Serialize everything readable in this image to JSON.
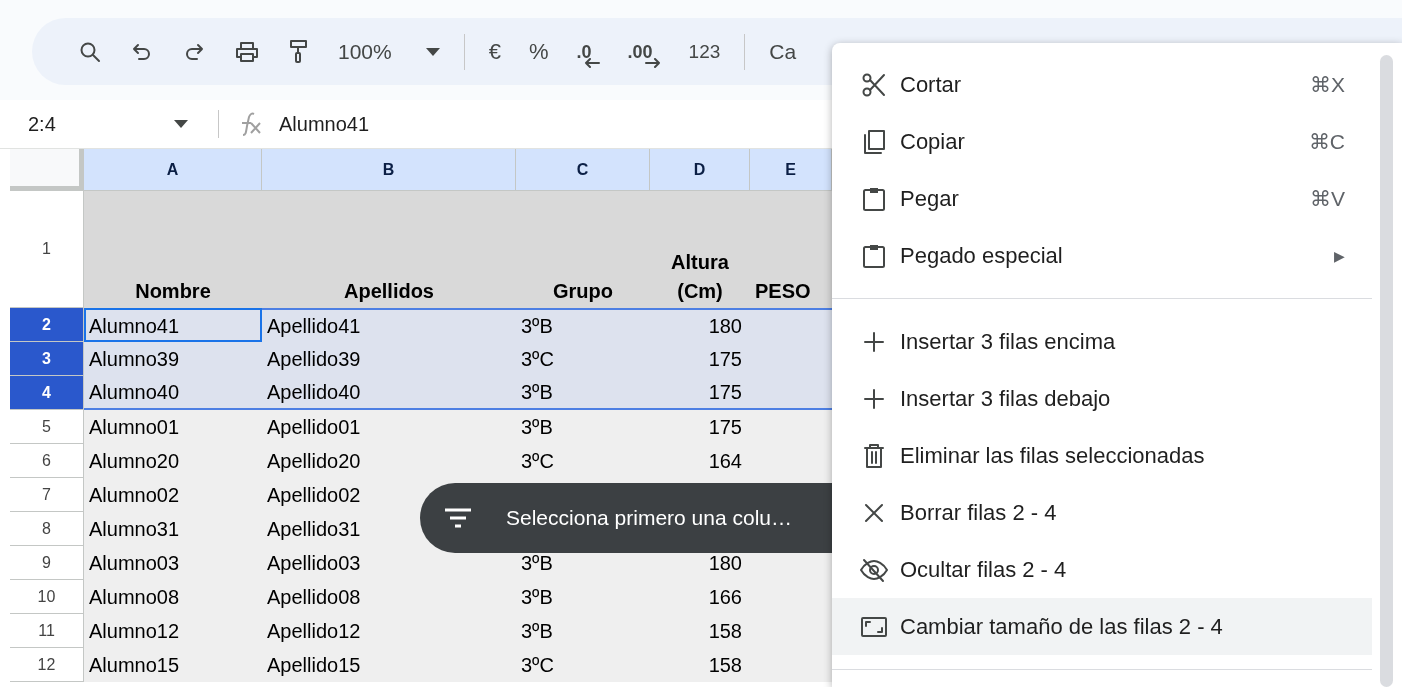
{
  "toolbar": {
    "zoom": "100%",
    "format_buttons": [
      {
        "kind": "currency",
        "label": "€"
      },
      {
        "kind": "percent",
        "label": "%"
      },
      {
        "kind": "decrease",
        "label": ".0"
      },
      {
        "kind": "increase",
        "label": ".00"
      },
      {
        "kind": "plain",
        "label": "123"
      }
    ],
    "font": "Ca"
  },
  "formula_bar": {
    "name_box": "2:4",
    "formula": "Alumno41"
  },
  "columns": [
    "A",
    "B",
    "C",
    "D",
    "E"
  ],
  "rows": [
    {
      "number": "1",
      "kind": "header",
      "selected": false,
      "cells": [
        {
          "text": "Nombre"
        },
        {
          "text": "Apellidos"
        },
        {
          "text": "Grupo"
        },
        {
          "text": "Altura (Cm)"
        },
        {
          "text": "PESO"
        }
      ]
    },
    {
      "number": "2",
      "kind": "data",
      "selected": true,
      "cells": [
        {
          "text": "Alumno41",
          "active": true
        },
        {
          "text": "Apellido41",
          "active": false
        },
        {
          "text": "3ºB",
          "active": false
        },
        {
          "text": "180",
          "active": false
        }
      ]
    },
    {
      "number": "3",
      "kind": "data",
      "selected": true,
      "cells": [
        {
          "text": "Alumno39",
          "active": false
        },
        {
          "text": "Apellido39",
          "active": false
        },
        {
          "text": "3ºC",
          "active": false
        },
        {
          "text": "175",
          "active": false
        }
      ]
    },
    {
      "number": "4",
      "kind": "data",
      "selected": true,
      "cells": [
        {
          "text": "Alumno40",
          "active": false
        },
        {
          "text": "Apellido40",
          "active": false
        },
        {
          "text": "3ºB",
          "active": false
        },
        {
          "text": "175",
          "active": false
        }
      ]
    },
    {
      "number": "5",
      "kind": "data",
      "selected": false,
      "cells": [
        {
          "text": "Alumno01",
          "active": false
        },
        {
          "text": "Apellido01",
          "active": false
        },
        {
          "text": "3ºB",
          "active": false
        },
        {
          "text": "175",
          "active": false
        }
      ]
    },
    {
      "number": "6",
      "kind": "data",
      "selected": false,
      "cells": [
        {
          "text": "Alumno20",
          "active": false
        },
        {
          "text": "Apellido20",
          "active": false
        },
        {
          "text": "3ºC",
          "active": false
        },
        {
          "text": "164",
          "active": false
        }
      ]
    },
    {
      "number": "7",
      "kind": "data",
      "selected": false,
      "cells": [
        {
          "text": "Alumno02",
          "active": false
        },
        {
          "text": "Apellido02",
          "active": false
        }
      ]
    },
    {
      "number": "8",
      "kind": "data",
      "selected": false,
      "cells": [
        {
          "text": "Alumno31",
          "active": false
        },
        {
          "text": "Apellido31",
          "active": false
        }
      ]
    },
    {
      "number": "9",
      "kind": "data",
      "selected": false,
      "cells": [
        {
          "text": "Alumno03",
          "active": false
        },
        {
          "text": "Apellido03",
          "active": false
        },
        {
          "text": "3ºB",
          "active": false
        },
        {
          "text": "180",
          "active": false
        }
      ]
    },
    {
      "number": "10",
      "kind": "data",
      "selected": false,
      "cells": [
        {
          "text": "Alumno08",
          "active": false
        },
        {
          "text": "Apellido08",
          "active": false
        },
        {
          "text": "3ºB",
          "active": false
        },
        {
          "text": "166",
          "active": false
        }
      ]
    },
    {
      "number": "11",
      "kind": "data",
      "selected": false,
      "cells": [
        {
          "text": "Alumno12",
          "active": false
        },
        {
          "text": "Apellido12",
          "active": false
        },
        {
          "text": "3ºB",
          "active": false
        },
        {
          "text": "158",
          "active": false
        }
      ]
    },
    {
      "number": "12",
      "kind": "data",
      "selected": false,
      "cells": [
        {
          "text": "Alumno15",
          "active": false
        },
        {
          "text": "Apellido15",
          "active": false
        },
        {
          "text": "3ºC",
          "active": false
        },
        {
          "text": "158",
          "active": false
        }
      ]
    }
  ],
  "toast": {
    "text": "Selecciona primero una colu…"
  },
  "context_menu": {
    "sections": [
      [
        {
          "kind": "cut",
          "label": "Cortar",
          "shortcut": "⌘X",
          "highlighted": false
        },
        {
          "kind": "copy",
          "label": "Copiar",
          "shortcut": "⌘C",
          "highlighted": false
        },
        {
          "kind": "paste",
          "label": "Pegar",
          "shortcut": "⌘V",
          "highlighted": false
        },
        {
          "kind": "paste",
          "label": "Pegado especial",
          "submenu": "▶",
          "highlighted": false
        }
      ],
      [
        {
          "kind": "insert",
          "label": "Insertar 3 filas encima",
          "highlighted": false
        },
        {
          "kind": "insert",
          "label": "Insertar 3 filas debajo",
          "highlighted": false
        },
        {
          "kind": "delete",
          "label": "Eliminar las filas seleccionadas",
          "highlighted": false
        },
        {
          "kind": "clear",
          "label": "Borrar filas 2 - 4",
          "highlighted": false
        },
        {
          "kind": "hide",
          "label": "Ocultar filas 2 - 4",
          "highlighted": false
        },
        {
          "kind": "resize",
          "label": "Cambiar tamaño de las filas 2 - 4",
          "highlighted": true
        }
      ]
    ]
  }
}
